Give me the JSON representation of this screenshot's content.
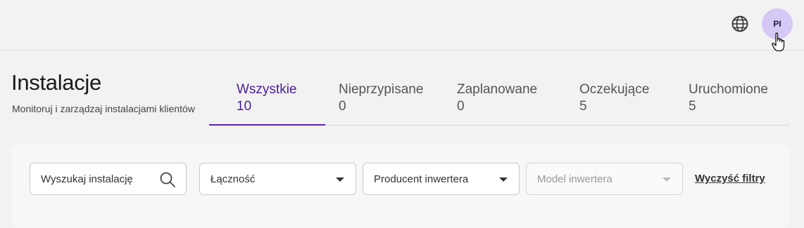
{
  "header": {
    "language_icon": "globe-icon",
    "user_initials": "PI"
  },
  "page": {
    "title": "Instalacje",
    "subtitle": "Monitoruj i zarządzaj instalacjami klientów"
  },
  "tabs": [
    {
      "label": "Wszystkie",
      "count": "10",
      "active": true
    },
    {
      "label": "Nieprzypisane",
      "count": "0",
      "active": false
    },
    {
      "label": "Zaplanowane",
      "count": "0",
      "active": false
    },
    {
      "label": "Oczekujące",
      "count": "5",
      "active": false
    },
    {
      "label": "Uruchomione",
      "count": "5",
      "active": false
    }
  ],
  "filters": {
    "search_placeholder": "Wyszukaj instalację",
    "connectivity": "Łączność",
    "inverter_producer": "Producent inwertera",
    "inverter_model": "Model inwertera",
    "clear_label": "Wyczyść filtry"
  },
  "colors": {
    "accent": "#5b21b6",
    "avatar_bg": "#d6c8f5",
    "background": "#f2f2f2"
  }
}
